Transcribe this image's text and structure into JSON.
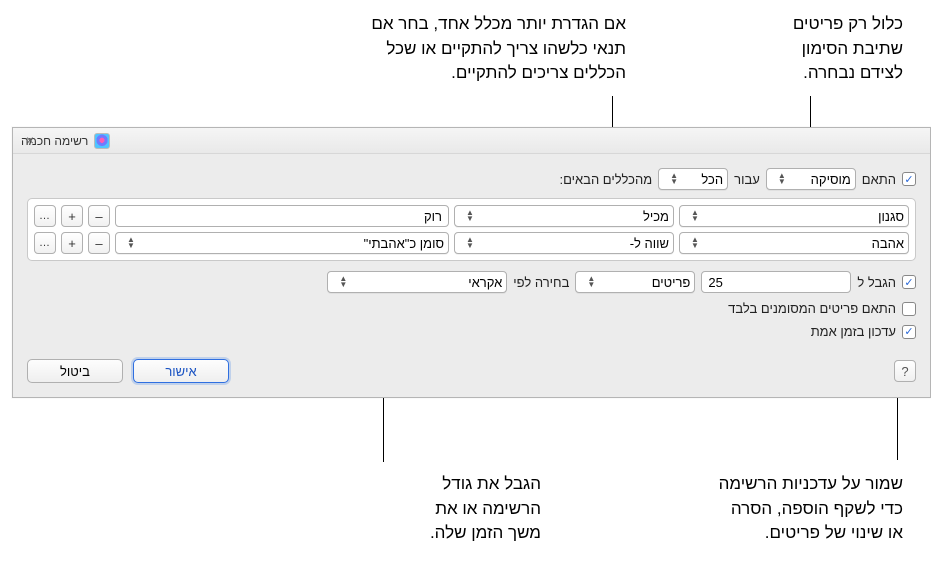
{
  "annotations": {
    "top_right": "כלול רק פריטים\nשתיבת הסימון\nלצידם נבחרה.",
    "top_center": "אם הגדרת יותר מכלל אחד, בחר אם\nתנאי כלשהו צריך להתקיים או שכל\nהכללים צריכים להתקיים.",
    "bottom_right": "שמור על עדכניות הרשימה\nכדי לשקף הוספה, הסרה\nאו שינוי של פריטים.",
    "bottom_center": "הגבל את גודל\nהרשימה או את\nמשך הזמן שלה."
  },
  "window": {
    "title": "רשימה חכמה"
  },
  "match": {
    "checkbox_label": "התאם",
    "media_select": "מוסיקה",
    "for_label": "עבור",
    "scope_select": "הכל",
    "suffix": "מהכללים הבאים:"
  },
  "rules": [
    {
      "field": "סגנון",
      "operator": "מכיל",
      "value_type": "text",
      "value": "רוק"
    },
    {
      "field": "אהבה",
      "operator": "שווה ל-",
      "value_type": "select",
      "value": "סומן כ\"אהבתי\""
    }
  ],
  "limit": {
    "checkbox_label": "הגבל ל",
    "count": "25",
    "unit_select": "פריטים",
    "selected_by_label": "בחירה לפי",
    "method_select": "אקראי"
  },
  "checked_only_label": "התאם פריטים המסומנים בלבד",
  "live_update_label": "עדכון בזמן אמת",
  "buttons": {
    "ok": "אישור",
    "cancel": "ביטול",
    "help": "?"
  },
  "icons": {
    "minus": "–",
    "plus": "+",
    "dots": "…"
  }
}
